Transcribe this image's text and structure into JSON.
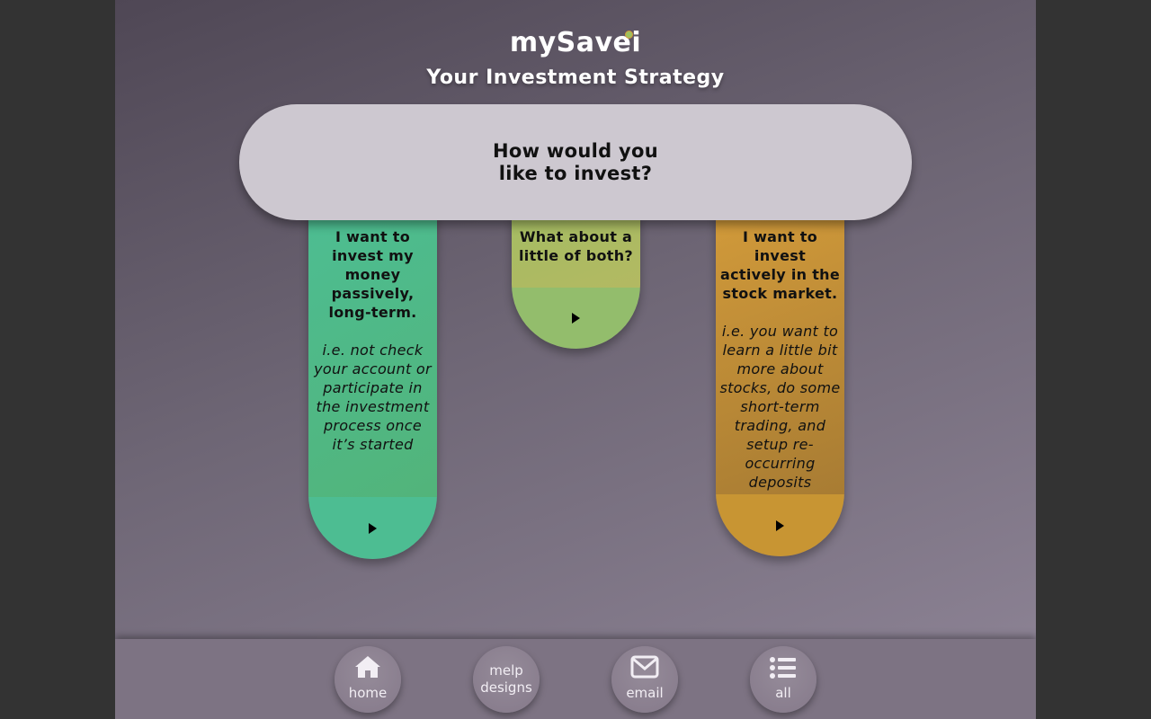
{
  "app": {
    "brand": "mySavei",
    "title": "Your Investment Strategy"
  },
  "question": {
    "text": "How would you like to invest?"
  },
  "options": [
    {
      "title": "I want to invest my money passively, long-term.",
      "description": "i.e. not check your account or participate in the investment process once it’s started",
      "color": "#4dbd92"
    },
    {
      "title": "What about a little of both?",
      "description": "",
      "color": "#93bd6c"
    },
    {
      "title": "I want to invest actively in the stock market.",
      "description": "i.e. you want to learn a little bit more about stocks, do some short-term trading, and setup re-occurring deposits",
      "color": "#c89533"
    }
  ],
  "nav": {
    "home_label": "home",
    "melp_label_line1": "melp",
    "melp_label_line2": "designs",
    "email_label": "email",
    "all_label": "all"
  },
  "icons": {
    "home": "home-icon",
    "email": "envelope-icon",
    "all": "list-icon",
    "play": "play-icon"
  }
}
